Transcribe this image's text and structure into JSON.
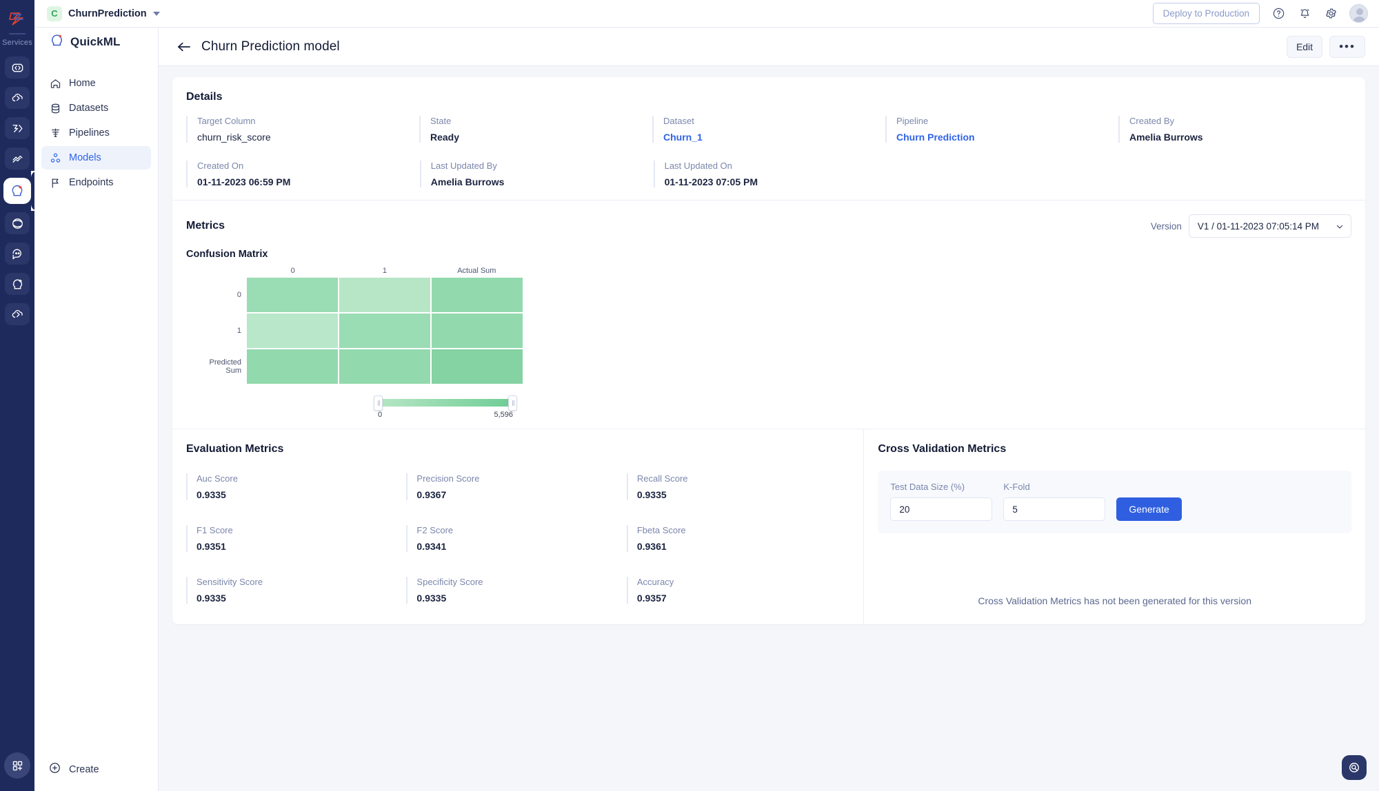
{
  "rail": {
    "logo_icon": "zoho-logo-icon",
    "services_label": "Services",
    "items": [
      {
        "name": "catalyst-code-icon",
        "active": false
      },
      {
        "name": "cloud-scale-icon",
        "active": false
      },
      {
        "name": "data-store-icon",
        "active": false
      },
      {
        "name": "app-sail-icon",
        "active": false
      },
      {
        "name": "quickml-icon",
        "active": true
      },
      {
        "name": "smart-browz-icon",
        "active": false
      },
      {
        "name": "zia-chat-icon",
        "active": false
      },
      {
        "name": "quickml-alt-icon",
        "active": false
      },
      {
        "name": "cloud-serverless-icon",
        "active": false
      }
    ],
    "bottom_icon": "apps-grid-icon"
  },
  "sidebar": {
    "brand": "QuickML",
    "brand_icon": "quickml-logo-icon",
    "items": [
      {
        "label": "Home",
        "icon": "home-icon",
        "active": false
      },
      {
        "label": "Datasets",
        "icon": "database-icon",
        "active": false
      },
      {
        "label": "Pipelines",
        "icon": "pipeline-icon",
        "active": false
      },
      {
        "label": "Models",
        "icon": "models-icon",
        "active": true
      },
      {
        "label": "Endpoints",
        "icon": "flag-icon",
        "active": false
      }
    ],
    "create_label": "Create",
    "create_icon": "plus-circle-icon"
  },
  "topbar": {
    "project_initial": "C",
    "project_name": "ChurnPrediction",
    "dropdown_icon": "chevron-down-icon",
    "deploy_label": "Deploy to Production",
    "help_icon": "help-circle-icon",
    "bell_icon": "bell-icon",
    "settings_icon": "gear-icon",
    "avatar_icon": "user-avatar"
  },
  "pagehead": {
    "back_icon": "arrow-left-icon",
    "title": "Churn Prediction model",
    "edit_label": "Edit",
    "more_label": "•••"
  },
  "details": {
    "title": "Details",
    "row1": [
      {
        "label": "Target Column",
        "value": "churn_risk_score",
        "link": false
      },
      {
        "label": "State",
        "value": "Ready",
        "link": false
      },
      {
        "label": "Dataset",
        "value": "Churn_1",
        "link": true
      },
      {
        "label": "Pipeline",
        "value": "Churn Prediction",
        "link": true
      },
      {
        "label": "Created By",
        "value": "Amelia Burrows",
        "link": false
      }
    ],
    "row2": [
      {
        "label": "Created On",
        "value": "01-11-2023 06:59 PM",
        "link": false
      },
      {
        "label": "Last Updated By",
        "value": "Amelia Burrows",
        "link": false
      },
      {
        "label": "Last Updated On",
        "value": "01-11-2023 07:05 PM",
        "link": false
      }
    ]
  },
  "metrics": {
    "title": "Metrics",
    "version_label": "Version",
    "version_value": "V1 / 01-11-2023 07:05:14 PM",
    "confusion_title": "Confusion Matrix"
  },
  "chart_data": {
    "type": "heatmap",
    "title": "Confusion Matrix",
    "x_categories": [
      "0",
      "1",
      "Actual Sum"
    ],
    "y_categories": [
      "0",
      "1",
      "Predicted Sum"
    ],
    "cells": [
      [
        {
          "color": "#9adcb4"
        },
        {
          "color": "#b6e6c6"
        },
        {
          "color": "#93d9ae"
        }
      ],
      [
        {
          "color": "#b9e7c9"
        },
        {
          "color": "#9adcb4"
        },
        {
          "color": "#93d9ae"
        }
      ],
      [
        {
          "color": "#93d9ae"
        },
        {
          "color": "#93d9ae"
        },
        {
          "color": "#85d2a3"
        }
      ]
    ],
    "colorbar": {
      "min": "0",
      "max": "5,596",
      "low_color": "#b6e6c5",
      "high_color": "#6ecd95"
    },
    "grid": false,
    "legend_position": "bottom"
  },
  "evaluation": {
    "title": "Evaluation Metrics",
    "items": [
      {
        "label": "Auc Score",
        "value": "0.9335"
      },
      {
        "label": "Precision Score",
        "value": "0.9367"
      },
      {
        "label": "Recall Score",
        "value": "0.9335"
      },
      {
        "label": "F1 Score",
        "value": "0.9351"
      },
      {
        "label": "F2 Score",
        "value": "0.9341"
      },
      {
        "label": "Fbeta Score",
        "value": "0.9361"
      },
      {
        "label": "Sensitivity Score",
        "value": "0.9335"
      },
      {
        "label": "Specificity Score",
        "value": "0.9335"
      },
      {
        "label": "Accuracy",
        "value": "0.9357"
      }
    ]
  },
  "cross_validation": {
    "title": "Cross Validation Metrics",
    "test_size_label": "Test Data Size (%)",
    "test_size_value": "20",
    "kfold_label": "K-Fold",
    "kfold_value": "5",
    "generate_label": "Generate",
    "empty_message": "Cross Validation Metrics has not been generated for this version"
  },
  "fab": {
    "icon": "search-help-icon"
  },
  "colors": {
    "accent": "#2f5fe0",
    "link": "#2f63e8",
    "rail_bg": "#1f2a5c"
  }
}
